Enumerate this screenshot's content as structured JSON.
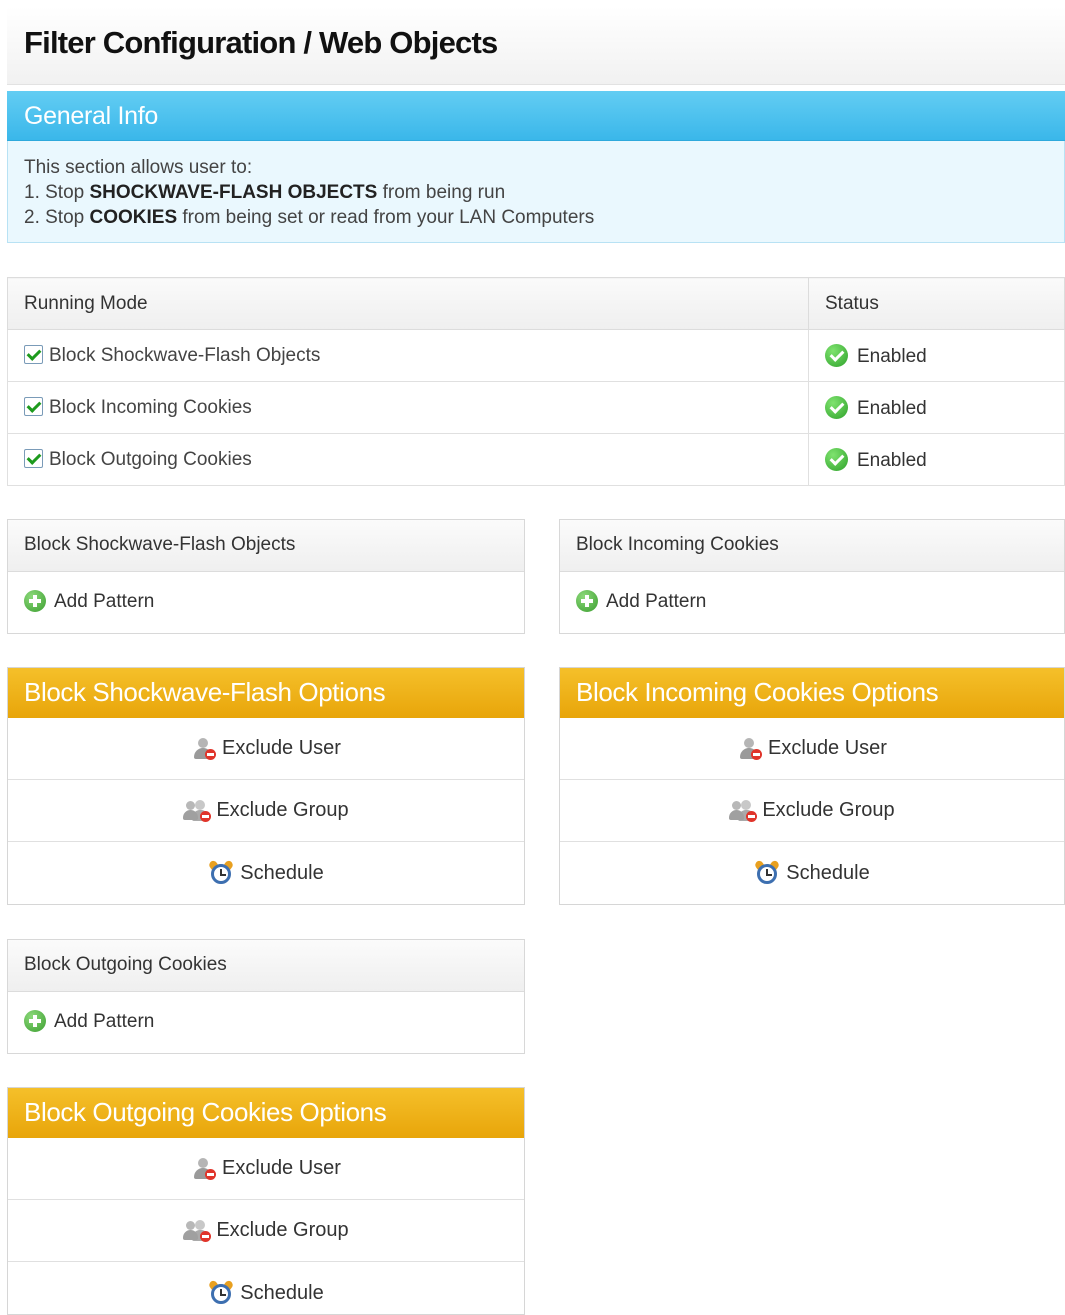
{
  "page": {
    "title": "Filter Configuration / Web Objects"
  },
  "general_info": {
    "title": "General Info",
    "line1": "This section allows user to:",
    "line2_prefix": "1. Stop ",
    "line2_bold": "SHOCKWAVE-FLASH OBJECTS",
    "line2_suffix": " from being run",
    "line3_prefix": "2. Stop ",
    "line3_bold": "COOKIES",
    "line3_suffix": " from being set or read from your LAN Computers"
  },
  "mode_table": {
    "headers": {
      "mode": "Running Mode",
      "status": "Status"
    },
    "rows": [
      {
        "label": "Block Shockwave-Flash Objects",
        "checked": true,
        "status": "Enabled"
      },
      {
        "label": "Block Incoming Cookies",
        "checked": true,
        "status": "Enabled"
      },
      {
        "label": "Block Outgoing Cookies",
        "checked": true,
        "status": "Enabled"
      }
    ]
  },
  "pattern_panels": {
    "flash": {
      "title": "Block Shockwave-Flash Objects",
      "action": "Add Pattern"
    },
    "incoming": {
      "title": "Block Incoming Cookies",
      "action": "Add Pattern"
    },
    "outgoing": {
      "title": "Block Outgoing Cookies",
      "action": "Add Pattern"
    }
  },
  "option_panels": {
    "flash": {
      "title": "Block Shockwave-Flash Options",
      "exclude_user": "Exclude User",
      "exclude_group": "Exclude Group",
      "schedule": "Schedule"
    },
    "incoming": {
      "title": "Block Incoming Cookies Options",
      "exclude_user": "Exclude User",
      "exclude_group": "Exclude Group",
      "schedule": "Schedule"
    },
    "outgoing": {
      "title": "Block Outgoing Cookies Options",
      "exclude_user": "Exclude User",
      "exclude_group": "Exclude Group",
      "schedule": "Schedule"
    }
  },
  "colors": {
    "info_blue": "#3ab7ea",
    "options_orange": "#f0b01a",
    "enabled_green": "#2ea12a",
    "stop_red": "#e0342a"
  }
}
